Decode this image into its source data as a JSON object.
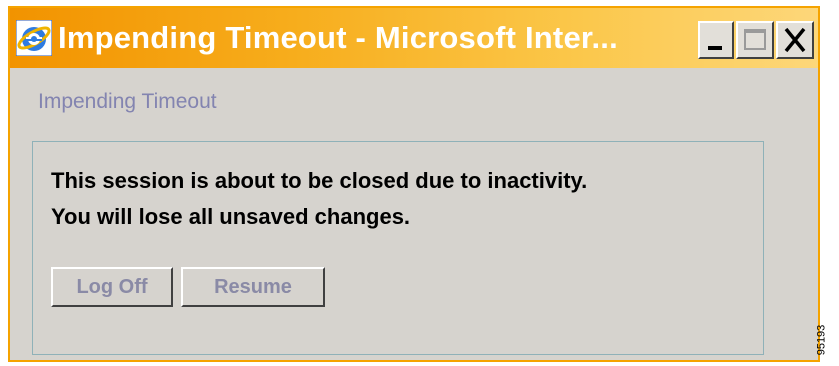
{
  "window": {
    "title": "Impending Timeout - Microsoft Inter...",
    "icon": "internet-explorer-icon",
    "controls": {
      "minimize_icon": "minimize-icon",
      "maximize_icon": "maximize-icon",
      "close_icon": "close-icon"
    }
  },
  "dialog": {
    "heading": "Impending Timeout",
    "message_line_1": "This session is about to be closed due to inactivity.",
    "message_line_2": "You will lose all unsaved changes.",
    "buttons": {
      "log_off": "Log Off",
      "resume": "Resume"
    }
  },
  "figure_id": "95193",
  "colors": {
    "titlebar_start": "#f29300",
    "titlebar_end": "#fdd77a",
    "window_bg": "#d6d3ce",
    "heading": "#8384b0",
    "button_text": "#8a8aa6",
    "box_border": "#8fb1b8"
  }
}
